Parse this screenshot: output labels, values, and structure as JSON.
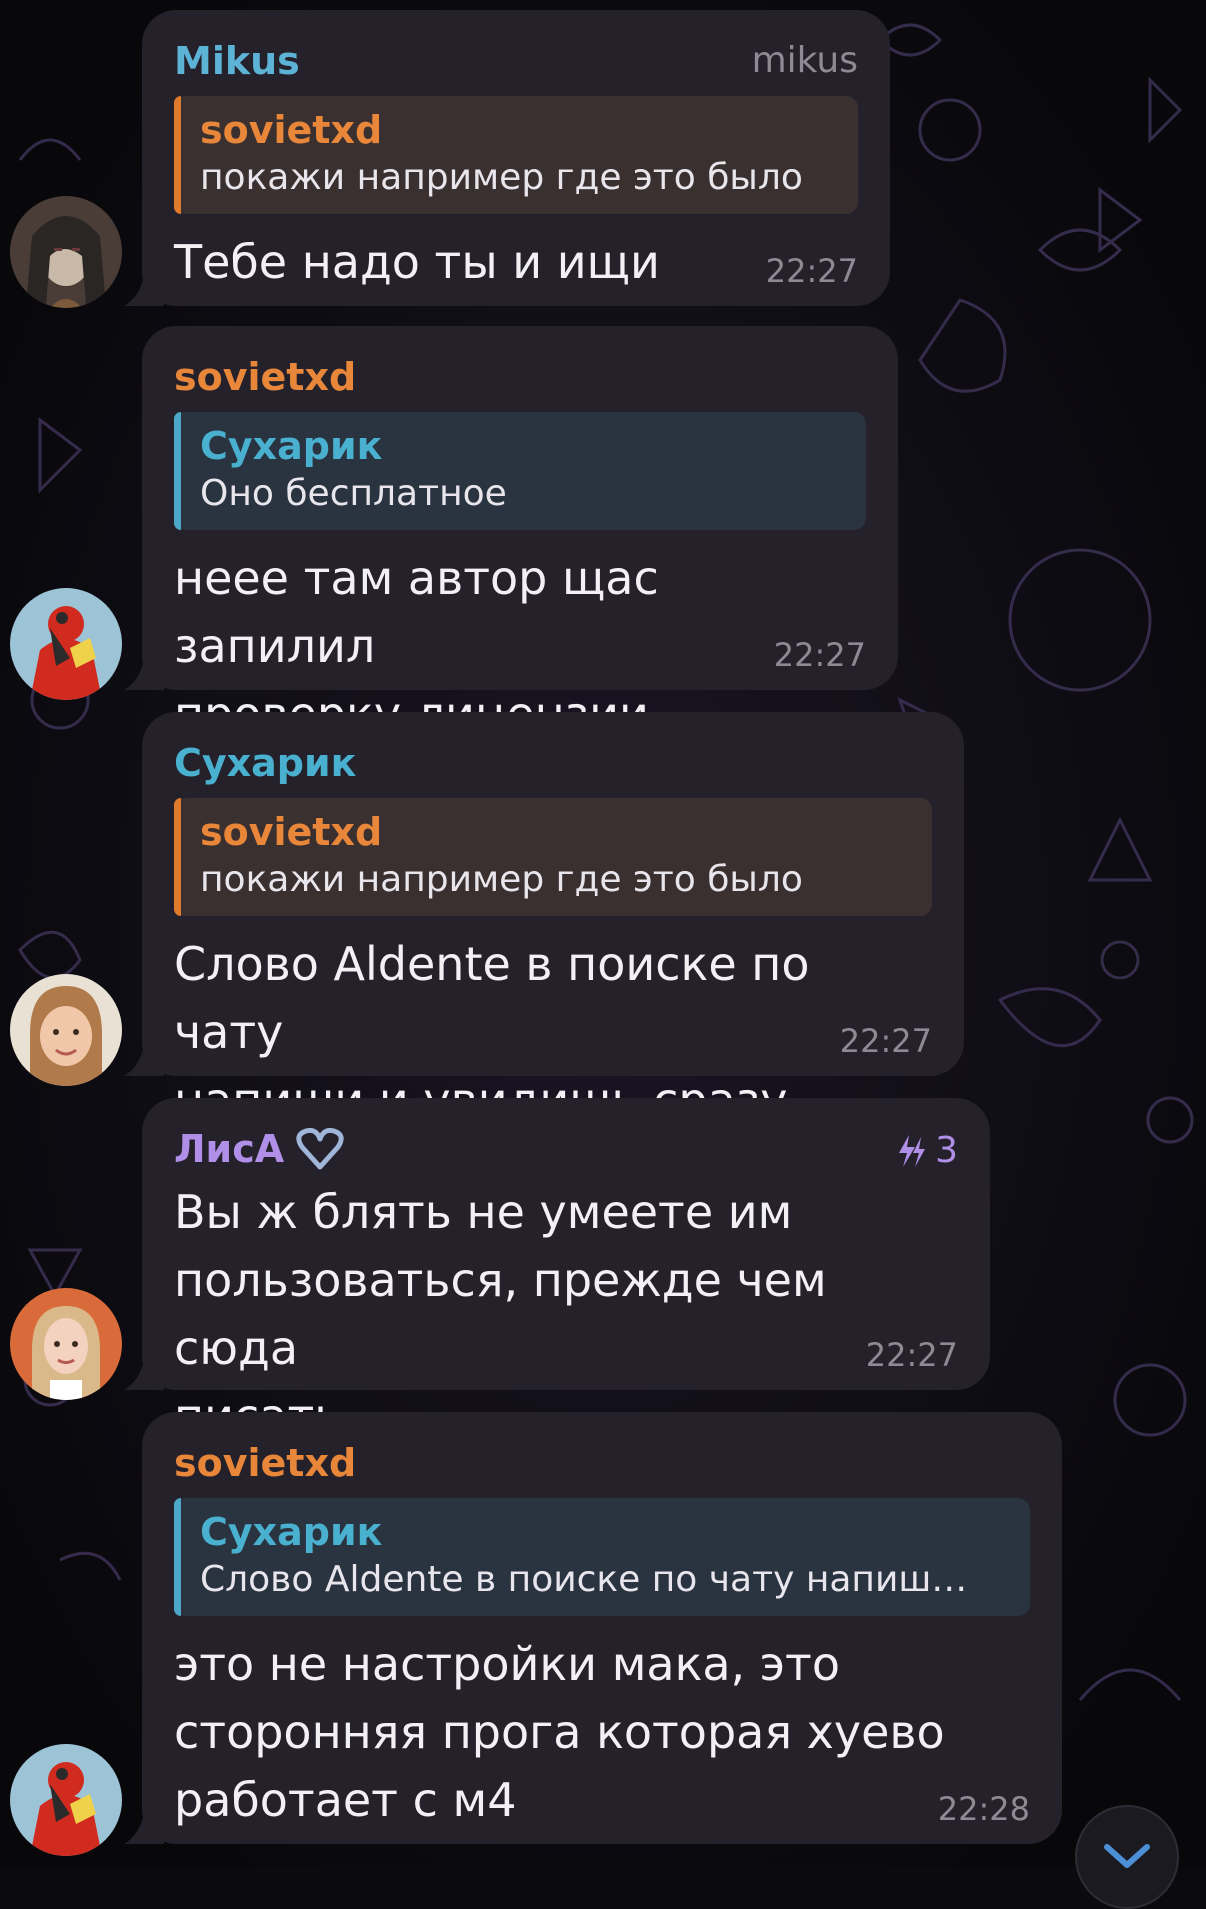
{
  "messages": [
    {
      "sender": "Mikus",
      "handle": "mikus",
      "reply": {
        "name": "sovietxd",
        "text": "покажи например где это было"
      },
      "text": "Тебе надо ты и ищи",
      "time": "22:27"
    },
    {
      "sender": "sovietxd",
      "reply": {
        "name": "Сухарик",
        "text": "Оно бесплатное"
      },
      "text": "неее там автор щас запилил\nпроверку лицензии",
      "time": "22:27"
    },
    {
      "sender": "Сухарик",
      "reply": {
        "name": "sovietxd",
        "text": "покажи например где это было"
      },
      "text": "Слово Aldente в поиске по чату\nнапиши и увидишь сразу",
      "time": "22:27"
    },
    {
      "sender": "ЛисА",
      "boost_count": "3",
      "text": "Вы ж блять не умеете им\nпользоваться, прежде чем сюда\nписать",
      "time": "22:27"
    },
    {
      "sender": "sovietxd",
      "reply": {
        "name": "Сухарик",
        "text": "Слово Aldente в поиске по чату напиш…"
      },
      "text": "это не настройки мака, это\nсторонняя прога которая хуево\nработает с м4",
      "time": "22:28"
    }
  ],
  "colors": {
    "orange": "#e8863a",
    "teal": "#4ab0cf",
    "purple": "#b08fe8",
    "bubble": "#24212b"
  },
  "icons": [
    "heart-icon",
    "boost-icon",
    "chevron-down-icon"
  ]
}
